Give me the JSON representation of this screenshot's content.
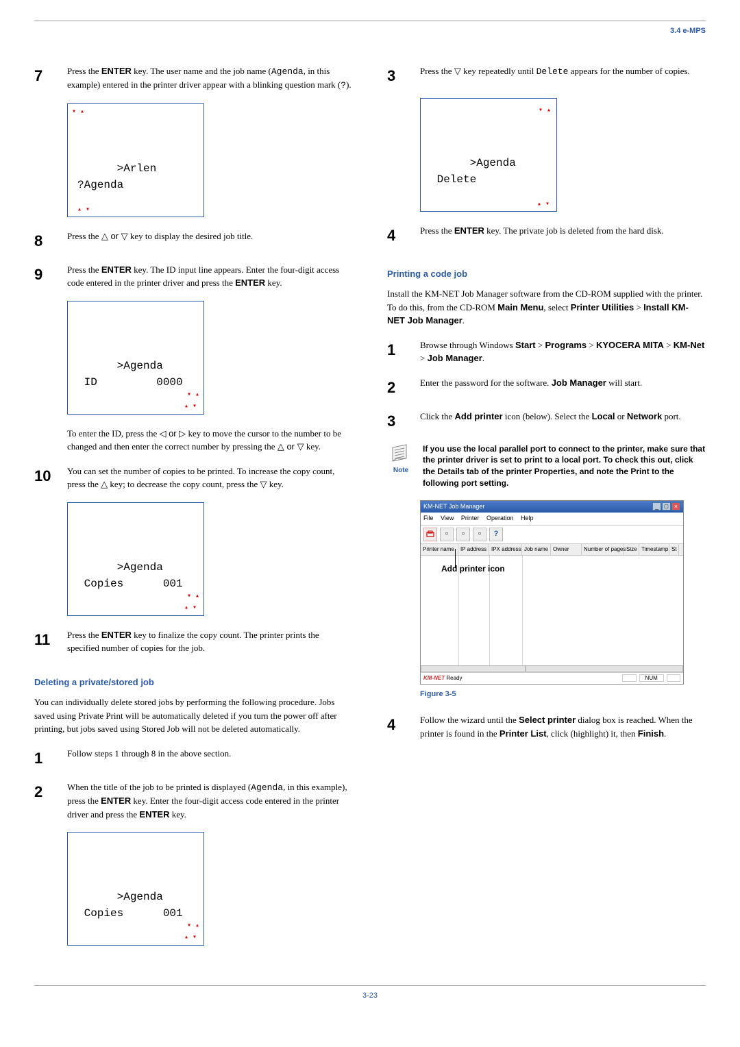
{
  "header": {
    "section": "3.4 e-MPS"
  },
  "left": {
    "s7": {
      "num": "7",
      "text_a": "Press the ",
      "enter": "ENTER",
      "text_b": " key. The user name and the job name (",
      "mono1": "Agenda",
      "text_c": ", in this example) entered in the printer driver appear with a blinking question mark (",
      "mono2": "?",
      "text_d": ")."
    },
    "lcd1": {
      "line1": ">Arlen",
      "line2": "?Agenda"
    },
    "s8": {
      "num": "8",
      "text_a": "Press the ",
      "tri": "△ or ▽",
      "text_b": " key to display the desired job title."
    },
    "s9": {
      "num": "9",
      "text_a": "Press the ",
      "enter1": "ENTER",
      "text_b": " key. The ID input line appears. Enter the four-digit access code entered in the printer driver and press the ",
      "enter2": "ENTER",
      "text_c": " key."
    },
    "lcd2": {
      "line1": ">Agenda",
      "line2": " ID         0000"
    },
    "s9b": {
      "text_a": "To enter the ID, press the ",
      "tri1": "◁ or ▷",
      "text_b": " key to move the cursor to the number to be changed and then enter the correct number by pressing the ",
      "tri2": "△ or ▽",
      "text_c": " key."
    },
    "s10": {
      "num": "10",
      "text_a": "You can set the number of copies to be printed. To increase the copy count, press the ",
      "tri1": "△",
      "text_b": " key; to decrease the copy count, press the ",
      "tri2": "▽",
      "text_c": " key."
    },
    "lcd3": {
      "line1": ">Agenda",
      "line2": " Copies      001"
    },
    "s11": {
      "num": "11",
      "text_a": "Press the ",
      "enter": "ENTER",
      "text_b": " key to finalize the copy count. The printer prints the specified number of copies for the job."
    },
    "sub1": "Deleting a private/stored job",
    "p1": "You can individually delete stored jobs by performing the following procedure. Jobs saved using Private Print will be automatically deleted if you turn the power off after printing, but jobs saved using Stored Job will not be deleted automatically.",
    "d1": {
      "num": "1",
      "text": "Follow steps 1 through 8 in the above section."
    },
    "d2": {
      "num": "2",
      "text_a": "When the title of the job to be printed is displayed (",
      "mono": "Agenda",
      "text_b": ", in this example), press the ",
      "enter1": "ENTER",
      "text_c": " key. Enter the four-digit access code entered in the printer driver and press the ",
      "enter2": "ENTER",
      "text_d": " key."
    },
    "lcd4": {
      "line1": ">Agenda",
      "line2": " Copies      001"
    }
  },
  "right": {
    "r3": {
      "num": "3",
      "text_a": "Press the ",
      "tri": "▽",
      "text_b": " key repeatedly until ",
      "mono": "Delete",
      "text_c": " appears for the number of copies."
    },
    "lcdR": {
      "line1": ">Agenda",
      "line2": " Delete"
    },
    "r4": {
      "num": "4",
      "text_a": "Press the ",
      "enter": "ENTER",
      "text_b": " key. The private job is deleted from the hard disk."
    },
    "sub2": "Printing a code job",
    "p2a": "Install the KM-NET Job Manager software from the CD-ROM supplied with the printer. To do this, from the CD-ROM ",
    "p2b": "Main Menu",
    "p2c": ", select ",
    "p2d": "Printer Utilities",
    "p2e": " > ",
    "p2f": "Install KM-NET Job Manager",
    "p2g": ".",
    "c1": {
      "num": "1",
      "text_a": "Browse through Windows ",
      "b1": "Start",
      "gt1": " > ",
      "b2": "Programs",
      "gt2": " > ",
      "b3": "KYOCERA MITA",
      "gt3": " > ",
      "b4": "KM-Net",
      "gt4": " > ",
      "b5": "Job Manager",
      "end": "."
    },
    "c2": {
      "num": "2",
      "text_a": "Enter the password for the software. ",
      "b": "Job Manager",
      "text_b": " will start."
    },
    "c3": {
      "num": "3",
      "text_a": "Click the ",
      "b1": "Add printer",
      "text_b": " icon (below). Select the ",
      "b2": "Local",
      "text_c": " or ",
      "b3": "Network",
      "text_d": " port."
    },
    "note": {
      "label": "Note",
      "text": "If you use the local parallel port to connect to the printer, make sure that the printer driver is set to print to a local port. To check this out, click the Details tab of the printer Properties, and note the Print to the following port setting."
    },
    "figure": {
      "title": "KM-NET Job Manager",
      "menu": {
        "file": "File",
        "view": "View",
        "printer": "Printer",
        "operation": "Operation",
        "help": "Help"
      },
      "cols": {
        "c1": "Printer name",
        "c2": "IP address",
        "c3": "IPX address",
        "c4": "Job name",
        "c5": "Owner",
        "c6": "Number of pages",
        "c7": "Size",
        "c8": "Timestamp",
        "c9": "St"
      },
      "callout": "Add printer icon",
      "status_ready": "Ready",
      "status_num": "NUM",
      "logo": "KM-NET"
    },
    "figcap": "Figure 3-5",
    "c4": {
      "num": "4",
      "text_a": "Follow the wizard until the ",
      "b1": "Select printer",
      "text_b": " dialog box is reached. When the printer is found in the ",
      "b2": "Printer List",
      "text_c": ", click (highlight) it, then ",
      "b3": "Finish",
      "text_d": "."
    }
  },
  "footer": {
    "page": "3-23"
  }
}
